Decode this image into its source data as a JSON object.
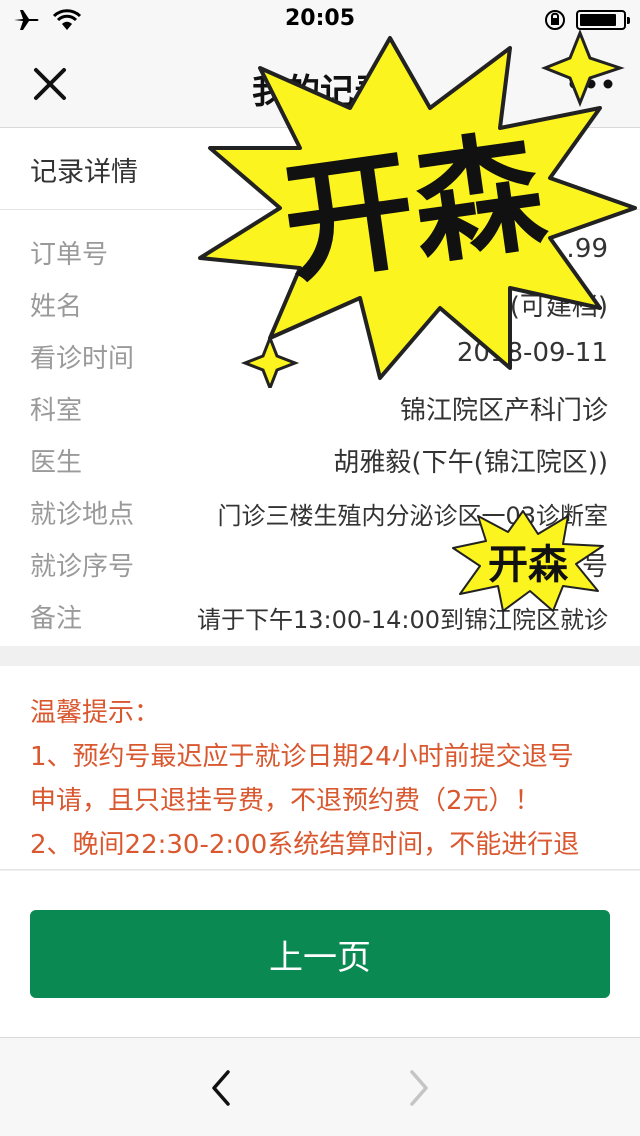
{
  "status_bar": {
    "time": "20:05",
    "icons": [
      "airplane-icon",
      "wifi-icon",
      "orientation-lock-icon",
      "battery-icon"
    ]
  },
  "nav": {
    "title": "我的记录",
    "close_icon": "close-icon",
    "more_icon": "more-icon"
  },
  "section": {
    "title": "记录详情"
  },
  "details": [
    {
      "label": "订单号",
      "value": "4200…99"
    },
    {
      "label": "姓名",
      "value": "(可建档)"
    },
    {
      "label": "看诊时间",
      "value": "2018-09-11"
    },
    {
      "label": "科室",
      "value": "锦江院区产科门诊"
    },
    {
      "label": "医生",
      "value": "胡雅毅(下午(锦江院区))"
    },
    {
      "label": "就诊地点",
      "value": "门诊三楼生殖内分泌诊区一03诊断室"
    },
    {
      "label": "就诊序号",
      "value": "号"
    },
    {
      "label": "备注",
      "value": "请于下午13:00-14:00到锦江院区就诊"
    }
  ],
  "tips": {
    "heading": "温馨提示：",
    "lines": [
      "1、预约号最迟应于就诊日期24小时前提交退号",
      "申请，且只退挂号费，不退预约费（2元）！",
      "2、晚间22:30-2:00系统结算时间，不能进行退"
    ]
  },
  "button": {
    "label": "上一页"
  },
  "toolbar": {
    "back_icon": "chevron-left-icon",
    "forward_icon": "chevron-right-icon"
  },
  "stickers": {
    "big_text": "开森",
    "small_text": "开森"
  },
  "colors": {
    "accent_green": "#0a8a52",
    "tip_red": "#d9582f",
    "sticker_yellow": "#fbf41e"
  }
}
